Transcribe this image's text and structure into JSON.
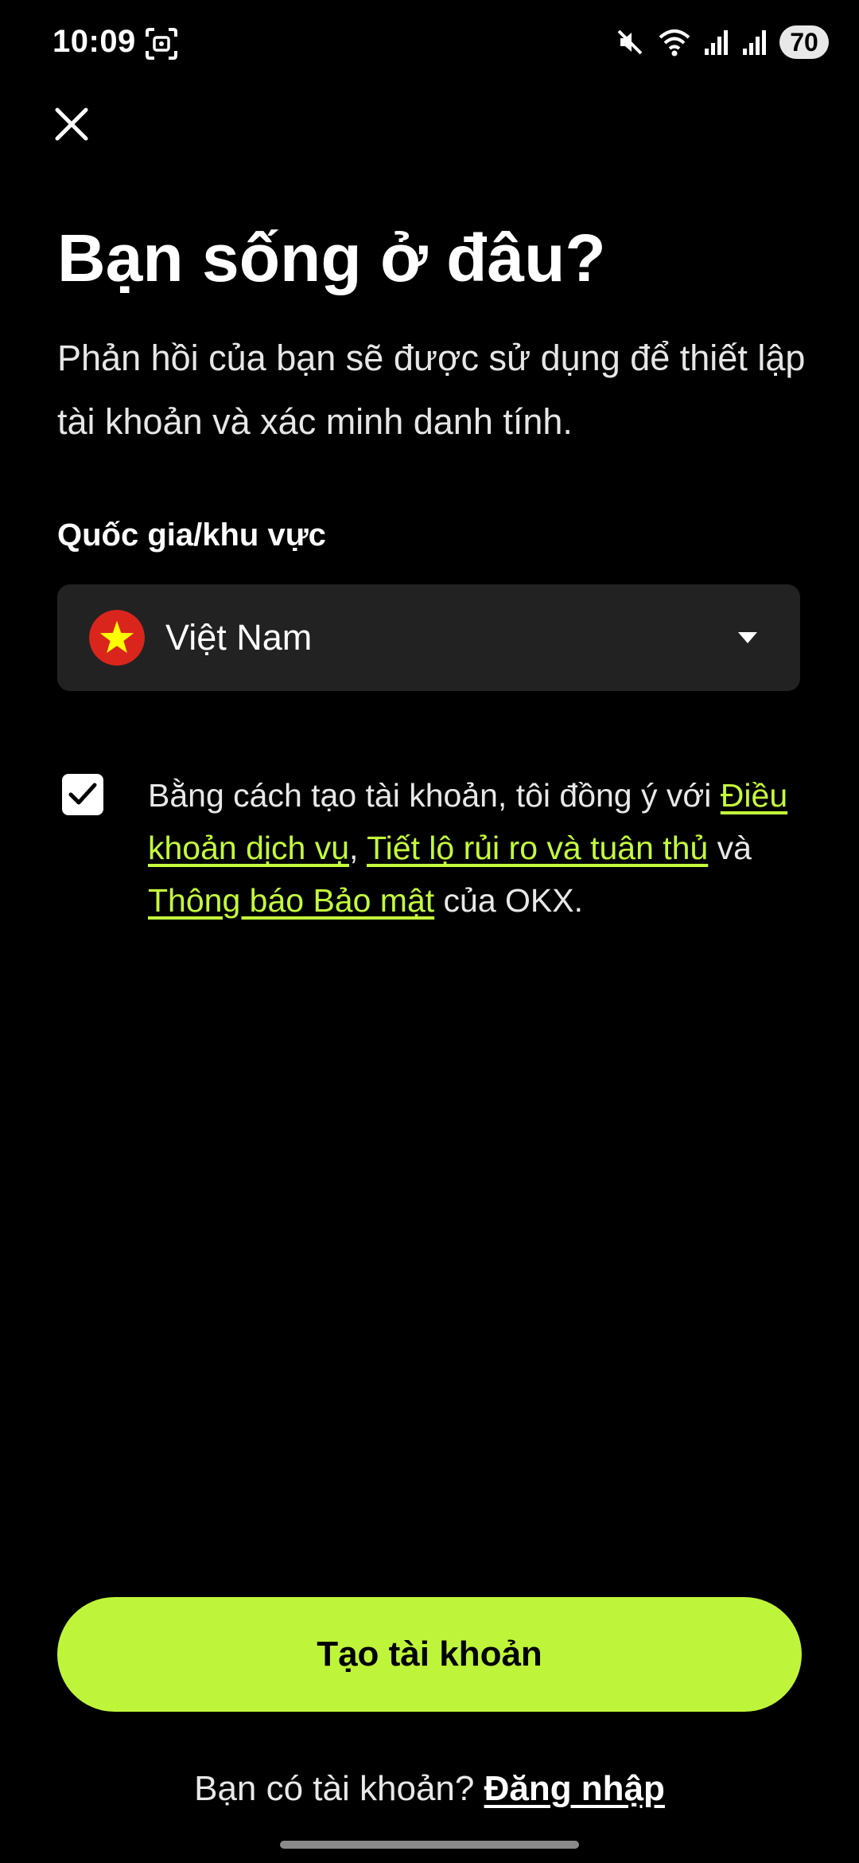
{
  "status_bar": {
    "time": "10:09",
    "battery": "70",
    "icons": [
      "screenshot-icon",
      "mute-icon",
      "wifi-icon",
      "signal-icon",
      "signal-icon"
    ]
  },
  "page": {
    "close_icon": "close-icon",
    "title": "Bạn sống ở đâu?",
    "subtitle": "Phản hồi của bạn sẽ được sử dụng để thiết lập tài khoản và xác minh danh tính."
  },
  "country_field": {
    "label": "Quốc gia/khu vực",
    "selected": "Việt Nam",
    "flag_icon": "vietnam-flag-icon"
  },
  "consent": {
    "checked": true,
    "text_before": "Bằng cách tạo tài khoản, tôi đồng ý với ",
    "link_terms": "Điều khoản dịch vụ",
    "sep1": ", ",
    "link_risk": "Tiết lộ rủi ro và tuân thủ",
    "sep2": " và ",
    "link_privacy": "Thông báo Bảo mật",
    "text_after": " của OKX."
  },
  "actions": {
    "create_account": "Tạo tài khoản",
    "have_account": "Bạn có tài khoản? ",
    "login": "Đăng nhập"
  },
  "colors": {
    "background": "#000000",
    "accent": "#bef53a",
    "link": "#c4fb3c",
    "field_bg": "#222222"
  }
}
